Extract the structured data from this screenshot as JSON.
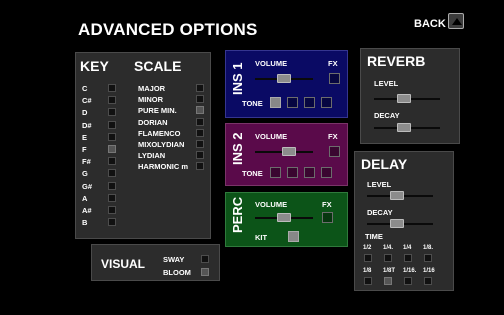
{
  "header": {
    "title": "ADVANCED OPTIONS",
    "back_label": "BACK"
  },
  "key_scale": {
    "key_header": "KEY",
    "scale_header": "SCALE",
    "keys": [
      {
        "label": "C",
        "on": false
      },
      {
        "label": "C#",
        "on": false
      },
      {
        "label": "D",
        "on": false
      },
      {
        "label": "D#",
        "on": false
      },
      {
        "label": "E",
        "on": false
      },
      {
        "label": "F",
        "on": true
      },
      {
        "label": "F#",
        "on": false
      },
      {
        "label": "G",
        "on": false
      },
      {
        "label": "G#",
        "on": false
      },
      {
        "label": "A",
        "on": false
      },
      {
        "label": "A#",
        "on": false
      },
      {
        "label": "B",
        "on": false
      }
    ],
    "scales": [
      {
        "label": "MAJOR",
        "on": false
      },
      {
        "label": "MINOR",
        "on": false
      },
      {
        "label": "PURE MIN.",
        "on": true
      },
      {
        "label": "DORIAN",
        "on": false
      },
      {
        "label": "FLAMENCO",
        "on": false
      },
      {
        "label": "MIXOLYDIAN",
        "on": false
      },
      {
        "label": "LYDIAN",
        "on": false
      },
      {
        "label": "HARMONIC m",
        "on": false
      }
    ]
  },
  "visual": {
    "label": "VISUAL",
    "sway_label": "SWAY",
    "sway_on": false,
    "bloom_label": "BLOOM",
    "bloom_on": true
  },
  "ins1": {
    "title": "INS 1",
    "volume_label": "VOLUME",
    "fx_label": "FX",
    "volume": 0.5,
    "fx_on": false,
    "tone_label": "TONE",
    "tones": [
      true,
      false,
      false,
      false
    ]
  },
  "ins2": {
    "title": "INS 2",
    "volume_label": "VOLUME",
    "fx_label": "FX",
    "volume": 0.58,
    "fx_on": false,
    "tone_label": "TONE",
    "tones": [
      false,
      false,
      false,
      false
    ]
  },
  "perc": {
    "title": "PERC",
    "volume_label": "VOLUME",
    "fx_label": "FX",
    "volume": 0.5,
    "fx_on": false,
    "kit_label": "KIT",
    "kit_on": true
  },
  "reverb": {
    "title": "REVERB",
    "level_label": "LEVEL",
    "level": 0.45,
    "decay_label": "DECAY",
    "decay": 0.45
  },
  "delay": {
    "title": "DELAY",
    "level_label": "LEVEL",
    "level": 0.45,
    "decay_label": "DECAY",
    "decay": 0.45,
    "time_label": "TIME",
    "times_row1": [
      {
        "label": "1/2",
        "on": false
      },
      {
        "label": "1/4.",
        "on": false
      },
      {
        "label": "1/4",
        "on": false
      },
      {
        "label": "1/8.",
        "on": false
      }
    ],
    "times_row2": [
      {
        "label": "1/8",
        "on": false
      },
      {
        "label": "1/8T",
        "on": true
      },
      {
        "label": "1/16.",
        "on": false
      },
      {
        "label": "1/16",
        "on": false
      }
    ]
  },
  "colors": {
    "ins1": "#0a0a64",
    "ins2": "#5a0a4a",
    "perc": "#0c5418",
    "panel": "#2c2c2c"
  }
}
